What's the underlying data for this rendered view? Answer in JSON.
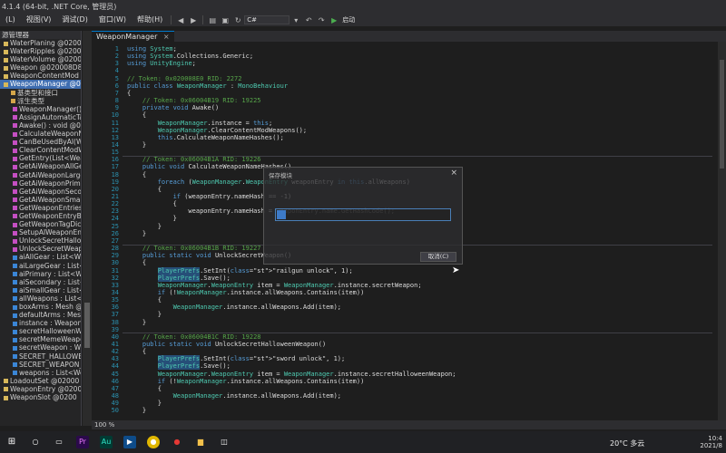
{
  "window": {
    "title": "4.1.4 (64-bit, .NET Core, 管理员)"
  },
  "menus": [
    "(L)",
    "视图(V)",
    "调试(D)",
    "窗口(W)",
    "帮助(H)"
  ],
  "toolbar": {
    "config_value": "C#",
    "run_label": "启动"
  },
  "left_panel": {
    "title": "源管理器",
    "items": [
      {
        "label": "WaterPlaning @020008",
        "kind": "class"
      },
      {
        "label": "WaterRipples @020009",
        "kind": "class"
      },
      {
        "label": "WaterVolume @02000",
        "kind": "class"
      },
      {
        "label": "Weapon @020008D8",
        "kind": "class"
      },
      {
        "label": "WeaponContentMod @",
        "kind": "class"
      },
      {
        "label": "WeaponManager @02",
        "kind": "class",
        "selected": true
      },
      {
        "label": "基类型和接口",
        "kind": "folder"
      },
      {
        "label": "派生类型",
        "kind": "folder"
      },
      {
        "label": "WeaponManager() :",
        "kind": "method"
      },
      {
        "label": "AssignAutomaticTag",
        "kind": "method"
      },
      {
        "label": "Awake() : void @060",
        "kind": "method"
      },
      {
        "label": "CalculateWeaponNa",
        "kind": "method"
      },
      {
        "label": "CanBeUsedByAI(Wea",
        "kind": "method"
      },
      {
        "label": "ClearContentModW",
        "kind": "method"
      },
      {
        "label": "GetEntry(List<Wea",
        "kind": "method"
      },
      {
        "label": "GetAiWeaponAllGea",
        "kind": "method"
      },
      {
        "label": "GetAiWeaponLarge",
        "kind": "method"
      },
      {
        "label": "GetAiWeaponPrimar",
        "kind": "method"
      },
      {
        "label": "GetAiWeaponSecon",
        "kind": "method"
      },
      {
        "label": "GetAiWeaponSmallG",
        "kind": "method"
      },
      {
        "label": "GetWeaponEntriesC",
        "kind": "method"
      },
      {
        "label": "GetWeaponEntryBy",
        "kind": "method"
      },
      {
        "label": "GetWeaponTagDicti",
        "kind": "method"
      },
      {
        "label": "SetupAIWeaponEntr",
        "kind": "method"
      },
      {
        "label": "UnlockSecretHallow",
        "kind": "method"
      },
      {
        "label": "UnlockSecretWeap",
        "kind": "method"
      },
      {
        "label": "aiAllGear : List<Wea",
        "kind": "field"
      },
      {
        "label": "aiLargeGear : List<W",
        "kind": "field"
      },
      {
        "label": "aiPrimary : List<We",
        "kind": "field"
      },
      {
        "label": "aiSecondary : List<W",
        "kind": "field"
      },
      {
        "label": "aiSmallGear : List<W",
        "kind": "field"
      },
      {
        "label": "allWeapons : List<W",
        "kind": "field"
      },
      {
        "label": "boxArms : Mesh @C",
        "kind": "field"
      },
      {
        "label": "defaultArms : Mesh",
        "kind": "field"
      },
      {
        "label": "instance : WeaponM",
        "kind": "field"
      },
      {
        "label": "secretHalloweenWea",
        "kind": "field"
      },
      {
        "label": "secretMemeWeapon",
        "kind": "field"
      },
      {
        "label": "secretWeapon : We",
        "kind": "field"
      },
      {
        "label": "SECRET_HALLOWEE",
        "kind": "field"
      },
      {
        "label": "SECRET_WEAPON_K",
        "kind": "field"
      },
      {
        "label": "weapons : List<We",
        "kind": "field"
      },
      {
        "label": "LoadoutSet @02000",
        "kind": "class"
      },
      {
        "label": "WeaponEntry @0200",
        "kind": "class"
      },
      {
        "label": "WeaponSlot @0200",
        "kind": "class"
      }
    ]
  },
  "tab": {
    "label": "WeaponManager",
    "close": "×"
  },
  "code_lines": [
    {
      "n": "1",
      "t": "using System;"
    },
    {
      "n": "2",
      "t": "using System.Collections.Generic;"
    },
    {
      "n": "3",
      "t": "using UnityEngine;"
    },
    {
      "n": "4",
      "t": ""
    },
    {
      "n": "5",
      "t": "// Token: 0x020008E0 RID: 2272"
    },
    {
      "n": "6",
      "t": "public class WeaponManager : MonoBehaviour"
    },
    {
      "n": "7",
      "t": "{"
    },
    {
      "n": "8",
      "t": "    // Token: 0x06004B19 RID: 19225"
    },
    {
      "n": "9",
      "t": "    private void Awake()"
    },
    {
      "n": "10",
      "t": "    {"
    },
    {
      "n": "11",
      "t": "        WeaponManager.instance = this;"
    },
    {
      "n": "12",
      "t": "        WeaponManager.ClearContentModWeapons();"
    },
    {
      "n": "13",
      "t": "        this.CalculateWeaponNameHashes();"
    },
    {
      "n": "14",
      "t": "    }"
    },
    {
      "n": "15",
      "t": ""
    },
    {
      "n": "16",
      "t": "    // Token: 0x06004B1A RID: 19226"
    },
    {
      "n": "17",
      "t": "    public void CalculateWeaponNameHashes()"
    },
    {
      "n": "18",
      "t": "    {"
    },
    {
      "n": "19",
      "t": "        foreach (WeaponManager.WeaponEntry weaponEntry in this.allWeapons)"
    },
    {
      "n": "20",
      "t": "        {"
    },
    {
      "n": "21",
      "t": "            if (weaponEntry.nameHash == -1)"
    },
    {
      "n": "22",
      "t": "            {"
    },
    {
      "n": "23",
      "t": "                weaponEntry.nameHash = weaponEntry.name.GetHashCode();"
    },
    {
      "n": "24",
      "t": "            }"
    },
    {
      "n": "25",
      "t": "        }"
    },
    {
      "n": "26",
      "t": "    }"
    },
    {
      "n": "27",
      "t": ""
    },
    {
      "n": "28",
      "t": "    // Token: 0x06004B1B RID: 19227"
    },
    {
      "n": "29",
      "t": "    public static void UnlockSecretWeapon()"
    },
    {
      "n": "30",
      "t": "    {"
    },
    {
      "n": "31",
      "t": "        PlayerPrefs.SetInt(\"railgun unlock\", 1);"
    },
    {
      "n": "32",
      "t": "        PlayerPrefs.Save();"
    },
    {
      "n": "33",
      "t": "        WeaponManager.WeaponEntry item = WeaponManager.instance.secretWeapon;"
    },
    {
      "n": "34",
      "t": "        if (!WeaponManager.instance.allWeapons.Contains(item))"
    },
    {
      "n": "35",
      "t": "        {"
    },
    {
      "n": "36",
      "t": "            WeaponManager.instance.allWeapons.Add(item);"
    },
    {
      "n": "37",
      "t": "        }"
    },
    {
      "n": "38",
      "t": "    }"
    },
    {
      "n": "39",
      "t": ""
    },
    {
      "n": "40",
      "t": "    // Token: 0x06004B1C RID: 19228"
    },
    {
      "n": "41",
      "t": "    public static void UnlockSecretHalloweenWeapon()"
    },
    {
      "n": "42",
      "t": "    {"
    },
    {
      "n": "43",
      "t": "        PlayerPrefs.SetInt(\"sword unlock\", 1);"
    },
    {
      "n": "44",
      "t": "        PlayerPrefs.Save();"
    },
    {
      "n": "45",
      "t": "        WeaponManager.WeaponEntry item = WeaponManager.instance.secretHalloweenWeapon;"
    },
    {
      "n": "46",
      "t": "        if (!WeaponManager.instance.allWeapons.Contains(item))"
    },
    {
      "n": "47",
      "t": "        {"
    },
    {
      "n": "48",
      "t": "            WeaponManager.instance.allWeapons.Add(item);"
    },
    {
      "n": "49",
      "t": "        }"
    },
    {
      "n": "50",
      "t": "    }"
    }
  ],
  "dialog": {
    "title": "保存模块",
    "close": "×",
    "cancel_label": "取消(C)",
    "progress": 0.05
  },
  "status": {
    "zoom": "100 %"
  },
  "taskbar": {
    "weather": "20°C 多云",
    "time": "10:4",
    "date": "2021/8"
  },
  "colors": {
    "accent": "#007acc",
    "selection": "#3e6db0",
    "progress": "#3d7ac7"
  }
}
